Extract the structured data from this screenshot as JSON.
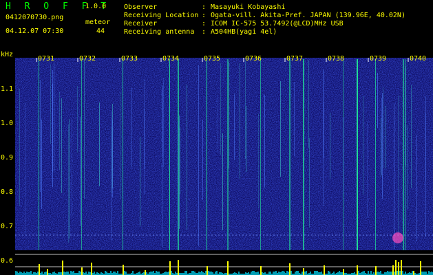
{
  "app": {
    "name": "H R O F F T",
    "version": "1.0.0"
  },
  "file": {
    "name": "0412070730.png",
    "datetime": "04.12.07 07:30"
  },
  "meteor": {
    "label": "meteor",
    "count": "44"
  },
  "info": {
    "rows": [
      {
        "label": "Observer",
        "sep": ":",
        "value": "Masayuki Kobayashi"
      },
      {
        "label": "Receiving Location",
        "sep": ":",
        "value": "Ogata-vill. Akita-Pref. JAPAN (139.96E, 40.02N)"
      },
      {
        "label": "Receiver",
        "sep": ":",
        "value": "ICOM IC-575 53.7492(@LCD)MHz USB"
      },
      {
        "label": "Receiving antenna",
        "sep": ":",
        "value": "A504HB(yagi 4el)"
      }
    ]
  },
  "axes": {
    "y_unit": "kHz",
    "y_ticks": [
      "1.1",
      "1.0",
      "0.9",
      "0.8",
      "0.7",
      "0.6"
    ],
    "time_ticks": [
      "0731",
      "0732",
      "0733",
      "0734",
      "0735",
      "0736",
      "0737",
      "0738",
      "0739",
      "0740"
    ]
  },
  "colors": {
    "background": "#000000",
    "header_text": "#ffff00",
    "title": "#00ff00",
    "spectrum_base": "#10106a",
    "echo": "#22ff99",
    "baseline": "#ffff00",
    "noise": "#00e0ff"
  }
}
